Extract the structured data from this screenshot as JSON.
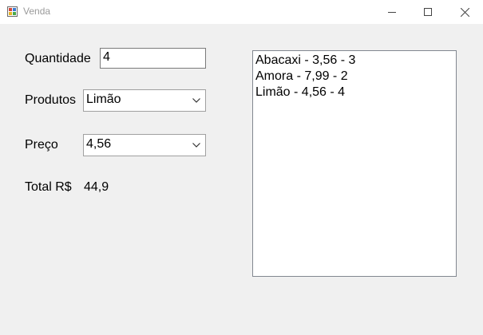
{
  "window": {
    "title": "Venda",
    "icons": {
      "app": "app-icon",
      "minimize": "minimize-icon",
      "maximize": "maximize-icon",
      "close": "close-icon"
    }
  },
  "form": {
    "quantidade_label": "Quantidade",
    "quantidade_value": "4",
    "produtos_label": "Produtos",
    "produtos_selected": "Limão",
    "preco_label": "Preço",
    "preco_selected": "4,56",
    "total_label": "Total R$",
    "total_value": "44,9"
  },
  "list": {
    "items": [
      "Abacaxi - 3,56 - 3",
      "Amora - 7,99 - 2",
      "Limão - 4,56 - 4"
    ]
  }
}
